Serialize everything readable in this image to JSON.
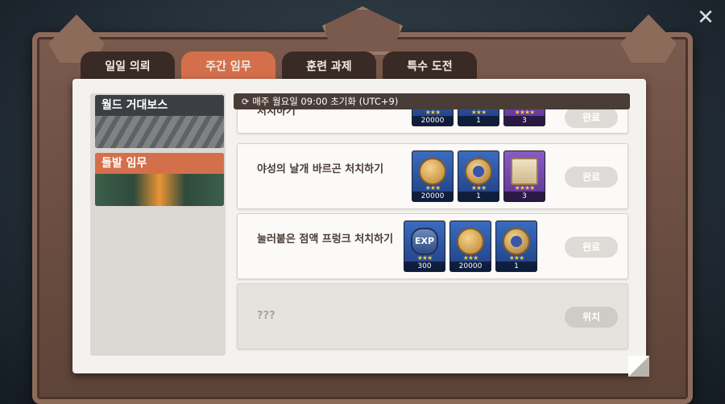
{
  "tabs": [
    {
      "label": "일일 의뢰",
      "active": false
    },
    {
      "label": "주간 임무",
      "active": true
    },
    {
      "label": "훈련 과제",
      "active": false
    },
    {
      "label": "특수 도전",
      "active": false
    }
  ],
  "close_icon": "close-x-icon",
  "categories": [
    {
      "label": "월드 거대보스",
      "active": false
    },
    {
      "label": "돌발 임무",
      "active": true
    }
  ],
  "reset_text": "매주 월요일 09:00 초기화 (UTC+9)",
  "missions": [
    {
      "title": "처치하기",
      "rewards": [
        {
          "icon": "gold-coin-icon",
          "stars": "★★★",
          "count": "20000",
          "color": "blue"
        },
        {
          "icon": "medal-icon",
          "stars": "★★★",
          "count": "1",
          "color": "blue"
        },
        {
          "icon": "scroll-icon",
          "stars": "★★★★",
          "count": "3",
          "color": "purple"
        }
      ],
      "action": "완료"
    },
    {
      "title": "야성의 날개 바르곤 처치하기",
      "rewards": [
        {
          "icon": "gold-coin-icon",
          "stars": "★★★",
          "count": "20000",
          "color": "blue"
        },
        {
          "icon": "medal-icon",
          "stars": "★★★",
          "count": "1",
          "color": "blue"
        },
        {
          "icon": "scroll-icon",
          "stars": "★★★★",
          "count": "3",
          "color": "purple"
        }
      ],
      "action": "완료"
    },
    {
      "title": "눌러붙은 점액 프렁크 처치하기",
      "rewards": [
        {
          "icon": "exp-icon",
          "label": "EXP",
          "stars": "★★★",
          "count": "300",
          "color": "blue"
        },
        {
          "icon": "gold-coin-icon",
          "stars": "★★★",
          "count": "20000",
          "color": "blue"
        },
        {
          "icon": "medal-icon",
          "stars": "★★★",
          "count": "1",
          "color": "blue"
        }
      ],
      "action": "완료"
    },
    {
      "title": "???",
      "rewards": [],
      "action": "위치"
    }
  ]
}
